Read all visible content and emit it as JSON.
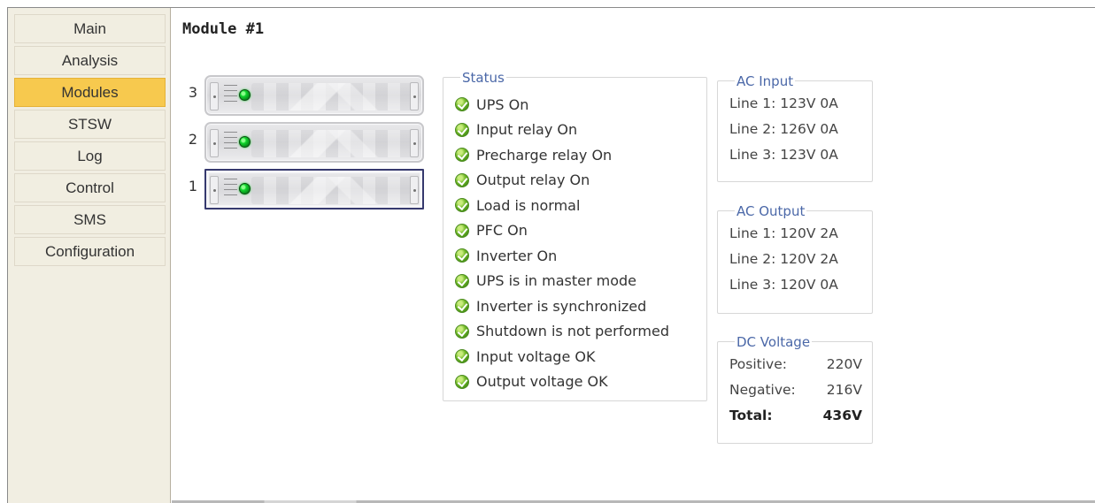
{
  "sidebar": {
    "items": [
      {
        "label": "Main"
      },
      {
        "label": "Analysis"
      },
      {
        "label": "Modules"
      },
      {
        "label": "STSW"
      },
      {
        "label": "Log"
      },
      {
        "label": "Control"
      },
      {
        "label": "SMS"
      },
      {
        "label": "Configuration"
      }
    ],
    "active_item": "Modules"
  },
  "page": {
    "title": "Module #1"
  },
  "modules": [
    {
      "number": "3",
      "selected": false,
      "status": "green"
    },
    {
      "number": "2",
      "selected": false,
      "status": "green"
    },
    {
      "number": "1",
      "selected": true,
      "status": "green"
    }
  ],
  "status": {
    "title": "Status",
    "items": [
      "UPS On",
      "Input relay On",
      "Precharge relay On",
      "Output relay On",
      "Load is normal",
      "PFC On",
      "Inverter On",
      "UPS is in master mode",
      "Inverter is synchronized",
      "Shutdown is not performed",
      "Input voltage OK",
      "Output voltage OK"
    ],
    "icon": "ok-check-icon"
  },
  "ac_input": {
    "title": "AC Input",
    "lines": [
      "Line 1: 123V 0A",
      "Line 2: 126V 0A",
      "Line 3: 123V 0A"
    ]
  },
  "ac_output": {
    "title": "AC Output",
    "lines": [
      "Line 1: 120V 2A",
      "Line 2: 120V 2A",
      "Line 3: 120V 0A"
    ]
  },
  "dc_voltage": {
    "title": "DC Voltage",
    "rows": [
      {
        "label": "Positive:",
        "value": "220V"
      },
      {
        "label": "Negative:",
        "value": "216V"
      },
      {
        "label": "Total:",
        "value": "436V"
      }
    ]
  },
  "colors": {
    "active_nav": "#f7c94e",
    "sidebar_background": "#f1eee2",
    "panel_title": "#4b68a8",
    "status_ok": "#62ad22",
    "module_led": "#11d62d"
  }
}
